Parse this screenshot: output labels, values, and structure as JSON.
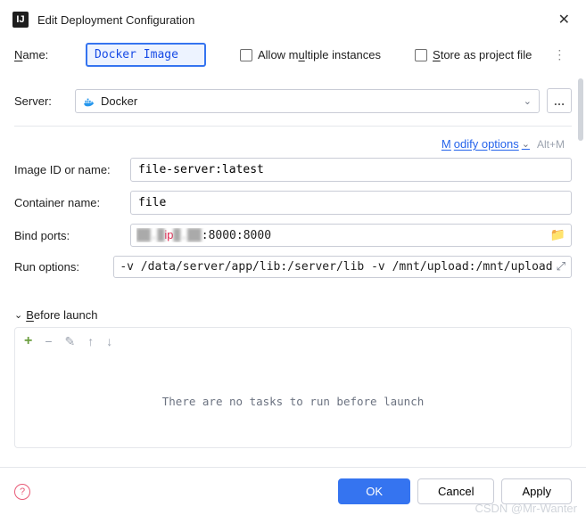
{
  "title": "Edit Deployment Configuration",
  "name": {
    "label": "Name:",
    "value": "Docker Image"
  },
  "allowMultiple": {
    "label": "Allow multiple instances"
  },
  "storeProject": {
    "label": "Store as project file"
  },
  "server": {
    "label": "Server:",
    "value": "Docker"
  },
  "modify": {
    "link": "Modify options",
    "hint": "Alt+M"
  },
  "image": {
    "label": "Image ID or name:",
    "value": "file-server:latest"
  },
  "container": {
    "label": "Container name:",
    "value": "file"
  },
  "bindPorts": {
    "label": "Bind ports:",
    "redacted": "ip",
    "value": ":8000:8000"
  },
  "runOptions": {
    "label": "Run options:",
    "value": "-v /data/server/app/lib:/server/lib -v /mnt/upload:/mnt/upload"
  },
  "beforeLaunch": {
    "label": "Before launch",
    "empty": "There are no tasks to run before launch"
  },
  "buttons": {
    "ok": "OK",
    "cancel": "Cancel",
    "apply": "Apply"
  },
  "watermark": "CSDN @Mr-Wanter"
}
